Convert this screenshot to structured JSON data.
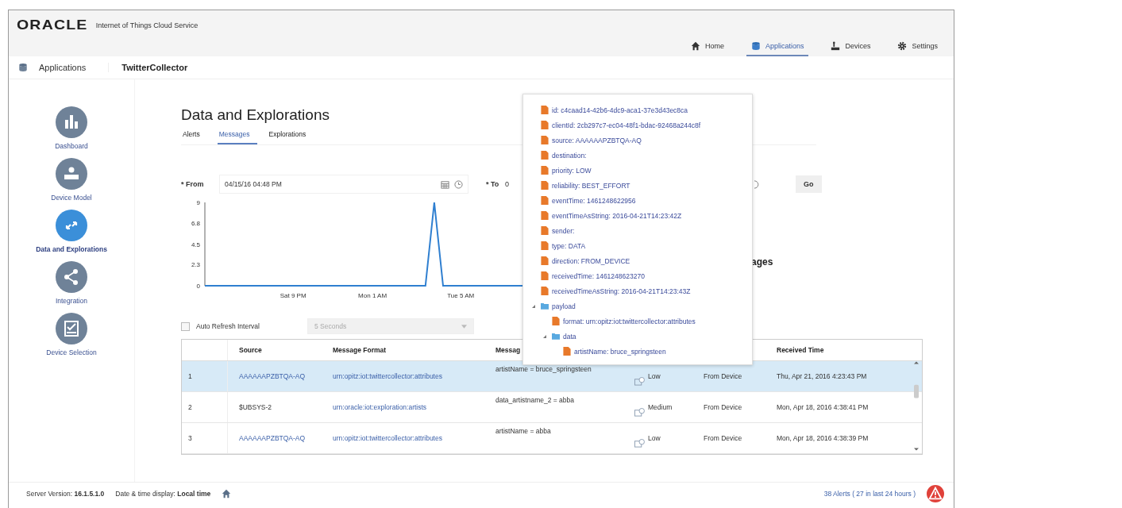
{
  "header": {
    "logo": "ORACLE",
    "product": "Internet of Things Cloud Service",
    "nav": [
      {
        "label": "Home",
        "kind": "home",
        "selected": false
      },
      {
        "label": "Applications",
        "kind": "database",
        "selected": true
      },
      {
        "label": "Devices",
        "kind": "device",
        "selected": false
      },
      {
        "label": "Settings",
        "kind": "gear",
        "selected": false
      }
    ]
  },
  "breadcrumb": {
    "section": "Applications",
    "app": "TwitterCollector"
  },
  "sidebar": {
    "items": [
      {
        "label": "Dashboard",
        "kind": "chart",
        "selected": false
      },
      {
        "label": "Device Model",
        "kind": "model",
        "selected": false
      },
      {
        "label": "Data and Explorations",
        "kind": "arrows",
        "selected": true
      },
      {
        "label": "Integration",
        "kind": "share",
        "selected": false
      },
      {
        "label": "Device Selection",
        "kind": "check",
        "selected": false
      }
    ]
  },
  "page": {
    "title": "Data and Explorations",
    "tabs": [
      {
        "label": "Alerts",
        "selected": false
      },
      {
        "label": "Messages",
        "selected": true
      },
      {
        "label": "Explorations",
        "selected": false
      }
    ]
  },
  "filter": {
    "from_mark": "*",
    "to_mark": "*",
    "from_label": "From",
    "from_value": "04/15/16 04:48 PM",
    "to_label": "To",
    "to_value": "0",
    "go": "Go"
  },
  "chart_data": {
    "type": "line",
    "categories": [
      null,
      null,
      null,
      null,
      null,
      null,
      null,
      null,
      null,
      null,
      "Sat 9 PM",
      null,
      null,
      null,
      null,
      null,
      null,
      null,
      null,
      "Mon 1 AM",
      null,
      null,
      null,
      null,
      null,
      null,
      null,
      null,
      null,
      "Tue 5 AM",
      null,
      null,
      null,
      null,
      null,
      null,
      null
    ],
    "series": [
      {
        "color": "#2f7fd0",
        "values": [
          0,
          0,
          0,
          0,
          0,
          0,
          0,
          0,
          0,
          0,
          0,
          0,
          0,
          0,
          0,
          0,
          0,
          0,
          0,
          0,
          0,
          0,
          0,
          0,
          0,
          0,
          9,
          0,
          0,
          0,
          0,
          0,
          0,
          0,
          0,
          0,
          0
        ]
      }
    ],
    "ylim": [
      0,
      9
    ],
    "yticks": [
      0,
      {
        "value": 2.3,
        "label": "2.3"
      },
      {
        "value": 4.5,
        "label": "4.5"
      },
      {
        "value": 6.8,
        "label": "6.8"
      },
      9
    ]
  },
  "heading_fragment": "ages",
  "auto_refresh": {
    "label": "Auto Refresh Interval",
    "checked": false,
    "interval": "5 Seconds",
    "disabled": true
  },
  "table": {
    "columns": {
      "source": "Source",
      "message_format": "Message Format",
      "message": "Messag",
      "received_time": "Received Time"
    },
    "rows": [
      {
        "number": "1",
        "source": "AAAAAAPZBTQA-AQ",
        "source_link": true,
        "format": "urn:opitz:iot:twittercollector:attributes",
        "message": "artistName = bruce_springsteen",
        "priority": "Low",
        "direction": "From Device",
        "received": "Thu, Apr 21, 2016 4:23:43 PM",
        "selected": true
      },
      {
        "number": "2",
        "source": "$UBSYS-2",
        "source_link": false,
        "format": "urn:oracle:iot:exploration:artists",
        "message": "data_artistname_2 = abba",
        "priority": "Medium",
        "direction": "From Device",
        "received": "Mon, Apr 18, 2016 4:38:41 PM",
        "selected": false
      },
      {
        "number": "3",
        "source": "AAAAAAPZBTQA-AQ",
        "source_link": true,
        "format": "urn:opitz:iot:twittercollector:attributes",
        "message": "artistName = abba",
        "priority": "Low",
        "direction": "From Device",
        "received": "Mon, Apr 18, 2016 4:38:39 PM",
        "selected": false
      }
    ]
  },
  "popover": {
    "items": [
      {
        "kind": "field",
        "text": "id: c4caad14-42b6-4dc9-aca1-37e3d43ec8ca"
      },
      {
        "kind": "field",
        "text": "clientId: 2cb297c7-ec04-48f1-bdac-92468a244c8f"
      },
      {
        "kind": "field",
        "text": "source: AAAAAAPZBTQA-AQ"
      },
      {
        "kind": "field",
        "text": "destination:"
      },
      {
        "kind": "field",
        "text": "priority: LOW"
      },
      {
        "kind": "field",
        "text": "reliability: BEST_EFFORT"
      },
      {
        "kind": "field",
        "text": "eventTime: 1461248622956"
      },
      {
        "kind": "field",
        "text": "eventTimeAsString: 2016-04-21T14:23:42Z"
      },
      {
        "kind": "field",
        "text": "sender:"
      },
      {
        "kind": "field",
        "text": "type: DATA"
      },
      {
        "kind": "field",
        "text": "direction: FROM_DEVICE"
      },
      {
        "kind": "field",
        "text": "receivedTime: 1461248623270"
      },
      {
        "kind": "field",
        "text": "receivedTimeAsString: 2016-04-21T14:23:43Z"
      },
      {
        "kind": "folder",
        "text": "payload",
        "expanded": true,
        "children": [
          {
            "kind": "field",
            "text": "format: urn:opitz:iot:twittercollector:attributes"
          },
          {
            "kind": "folder",
            "text": "data",
            "expanded": true,
            "children": [
              {
                "kind": "field",
                "text": "artistName: bruce_springsteen"
              }
            ]
          }
        ]
      }
    ]
  },
  "footer": {
    "version": "Server Version: **16.1.5.1.0**",
    "datetime": "Date & time display: **Local time**",
    "alerts": "38 Alerts ( 27 in last 24 hours )"
  }
}
